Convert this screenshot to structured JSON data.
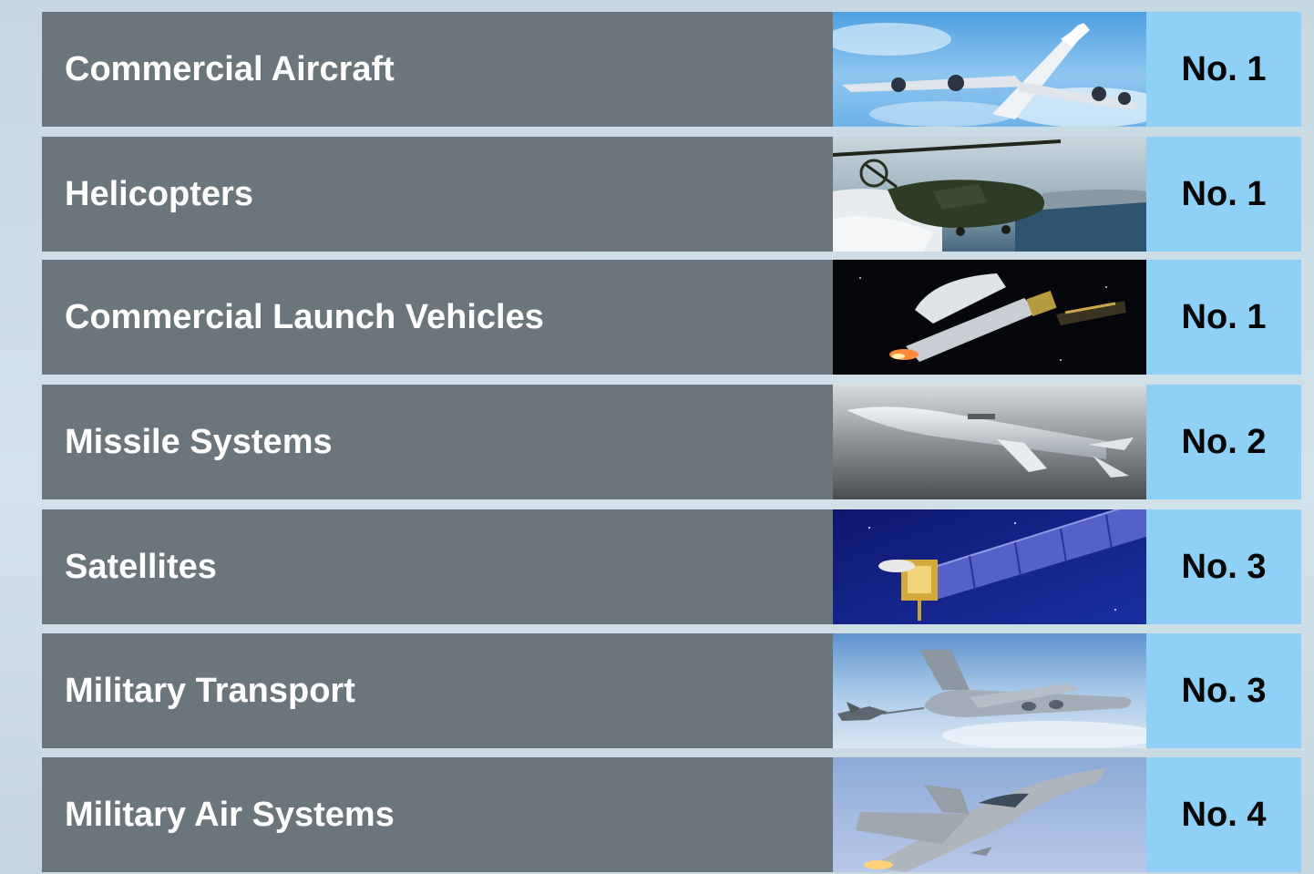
{
  "colors": {
    "page_background": "#c9d9e1",
    "category_cell": "#6a757c",
    "rank_cell": "#8fd0f6",
    "category_text": "#ffffff",
    "rank_text": "#050505"
  },
  "rows": [
    {
      "category": "Commercial Aircraft",
      "rank": "No. 1",
      "image": "airliner-in-sky"
    },
    {
      "category": "Helicopters",
      "rank": "No. 1",
      "image": "military-helicopter-over-coast"
    },
    {
      "category": "Commercial Launch Vehicles",
      "rank": "No. 1",
      "image": "launch-vehicle-in-space"
    },
    {
      "category": "Missile Systems",
      "rank": "No. 2",
      "image": "cruise-missile"
    },
    {
      "category": "Satellites",
      "rank": "No. 3",
      "image": "satellite-with-solar-array"
    },
    {
      "category": "Military Transport",
      "rank": "No. 3",
      "image": "transport-aircraft-refueling-jet"
    },
    {
      "category": "Military Air Systems",
      "rank": "No. 4",
      "image": "fighter-jet"
    }
  ]
}
